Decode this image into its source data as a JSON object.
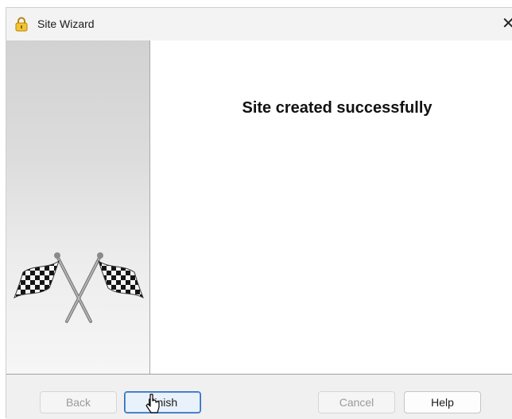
{
  "window": {
    "title": "Site Wizard",
    "close_label": "✕"
  },
  "content": {
    "heading": "Site created successfully"
  },
  "side_panel": {
    "image": "checkered-flags"
  },
  "footer": {
    "back_label": "Back",
    "finish_label": "Finish",
    "cancel_label": "Cancel",
    "help_label": "Help"
  },
  "colors": {
    "focus_border": "#2f6fc0",
    "panel_gradient_top": "#d2d2d2",
    "panel_gradient_bottom": "#f6f6f6"
  }
}
